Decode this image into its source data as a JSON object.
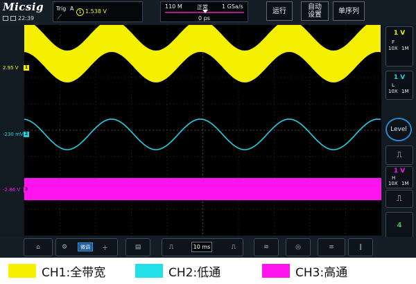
{
  "app": {
    "brand": "Micsig",
    "clock": "22:39"
  },
  "trigger": {
    "label": "Trig",
    "source_letter": "A",
    "channel": "1",
    "level": "1.538  V"
  },
  "timebase": {
    "memory": "110 M",
    "mode": "正常",
    "sample_rate": "1 GSa/s",
    "delay": "0 ps",
    "scale": "10 ms"
  },
  "toolbar": {
    "run_label": "运行",
    "auto_label": "自动\n设置",
    "single_label": "单序列"
  },
  "channels": [
    {
      "id": "1",
      "offset": "2.95 V",
      "color": "#f5f000",
      "volts": "1 V",
      "coupling": "F",
      "probe": "10X",
      "impedance": "1M"
    },
    {
      "id": "2",
      "offset": "-230 mV",
      "color": "#22d3e6",
      "volts": "1 V",
      "coupling": "L",
      "probe": "10X",
      "impedance": "1M"
    },
    {
      "id": "3",
      "offset": "-2.86 V",
      "color": "#ff14f0",
      "volts": "1 V",
      "coupling": "H",
      "probe": "10X",
      "impedance": "1M"
    }
  ],
  "right_panel": {
    "level_label": "Level",
    "ch4_label": "4"
  },
  "bottom": {
    "fine_label": "微调"
  },
  "legend": [
    {
      "label": "CH1:全带宽",
      "color": "#f5f000"
    },
    {
      "label": "CH2:低通",
      "color": "#22e0e8"
    },
    {
      "label": "CH3:高通",
      "color": "#ff14f0"
    }
  ],
  "icons": [
    "home-icon",
    "gear-icon",
    "plus-icon",
    "save-icon",
    "pulse-icon",
    "measure-icon",
    "cursor-icon",
    "math-icon"
  ]
}
